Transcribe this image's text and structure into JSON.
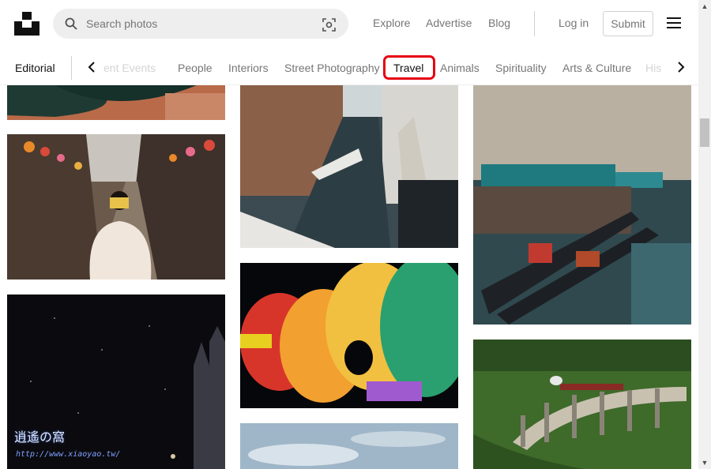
{
  "header": {
    "search_placeholder": "Search photos",
    "nav": {
      "explore": "Explore",
      "advertise": "Advertise",
      "blog": "Blog",
      "login": "Log in"
    },
    "submit_label": "Submit"
  },
  "topics": {
    "editorial": "Editorial",
    "items": [
      "ent Events",
      "People",
      "Interiors",
      "Street Photography",
      "Travel",
      "Animals",
      "Spirituality",
      "Arts & Culture",
      "His"
    ],
    "active": "Travel"
  },
  "watermark": {
    "text": "逍遙の窩",
    "url": "http://www.xiaoyao.tw/"
  },
  "colors": {
    "highlight": "#e60012",
    "muted_text": "#767676"
  }
}
